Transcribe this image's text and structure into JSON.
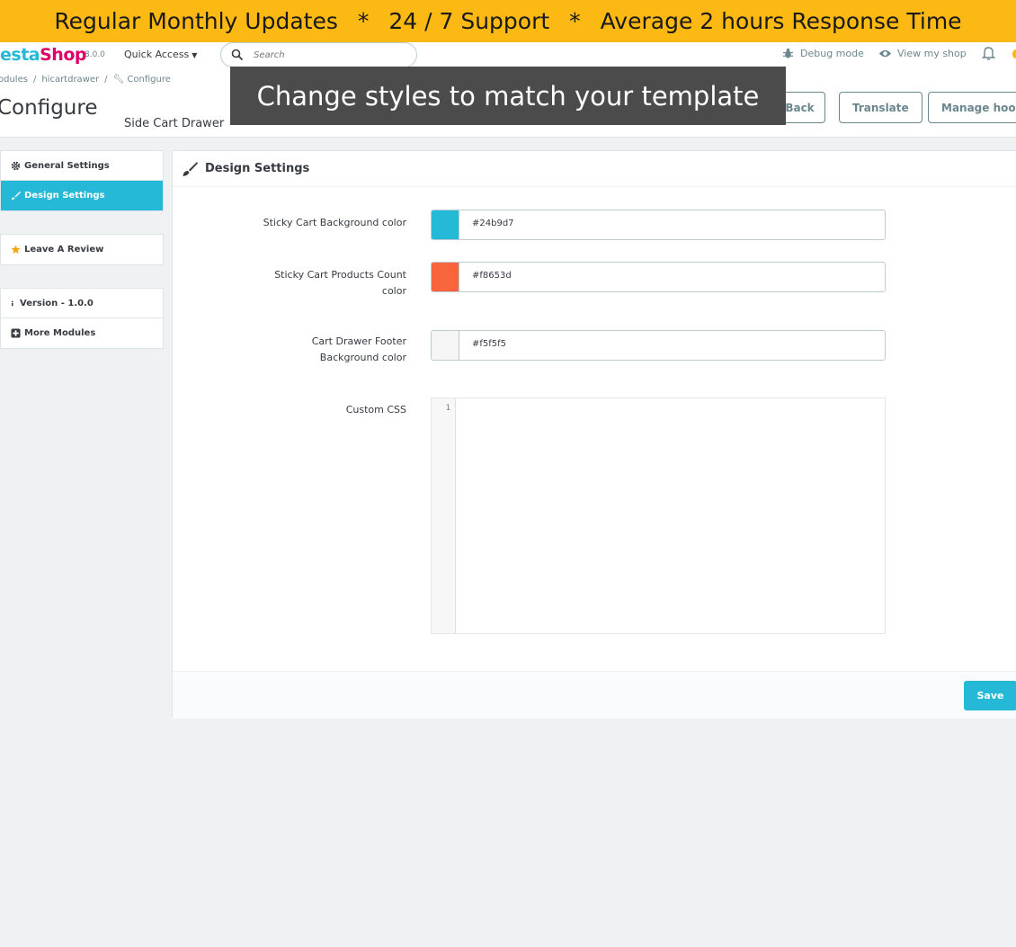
{
  "promo": {
    "part1": "Regular Monthly Updates",
    "star": "*",
    "part2": "24 / 7 Support",
    "part3": "Average 2 hours Response Time",
    "bg_color": "#fdb913"
  },
  "header": {
    "logo_pre": "esta",
    "logo_shop": "Shop",
    "version": "8.0.0",
    "quick_access": "Quick Access",
    "search_placeholder": "Search",
    "debug_mode": "Debug mode",
    "view_shop": "View my shop"
  },
  "toolbar": {
    "breadcrumb": [
      "odules",
      "hicartdrawer",
      "Configure"
    ],
    "breadcrumb_sep": "/",
    "page_title": "Configure",
    "subtitle": "Side Cart Drawer",
    "back": "Back",
    "translate": "Translate",
    "manage_hooks": "Manage hooks"
  },
  "overlay": {
    "text": "Change styles to match your template"
  },
  "sidebar": {
    "general_settings": "General Settings",
    "design_settings": "Design Settings",
    "leave_review": "Leave A Review",
    "version": "Version - 1.0.0",
    "more_modules": "More Modules"
  },
  "panel": {
    "title": "Design Settings",
    "fields": [
      {
        "label_line1": "Sticky Cart Background color",
        "label_line2": "",
        "value": "#24b9d7"
      },
      {
        "label_line1": "Sticky Cart Products Count",
        "label_line2": "color",
        "value": "#f8653d"
      },
      {
        "label_line1": "Cart Drawer Footer",
        "label_line2": "Background color",
        "value": "#f5f5f5"
      }
    ],
    "custom_css_label": "Custom CSS",
    "code_line": "1",
    "save": "Save"
  },
  "colors": {
    "accent": "#25b9d7",
    "swatch_1": "#24b9d7",
    "swatch_2": "#f8653d",
    "swatch_3": "#f5f5f5"
  }
}
